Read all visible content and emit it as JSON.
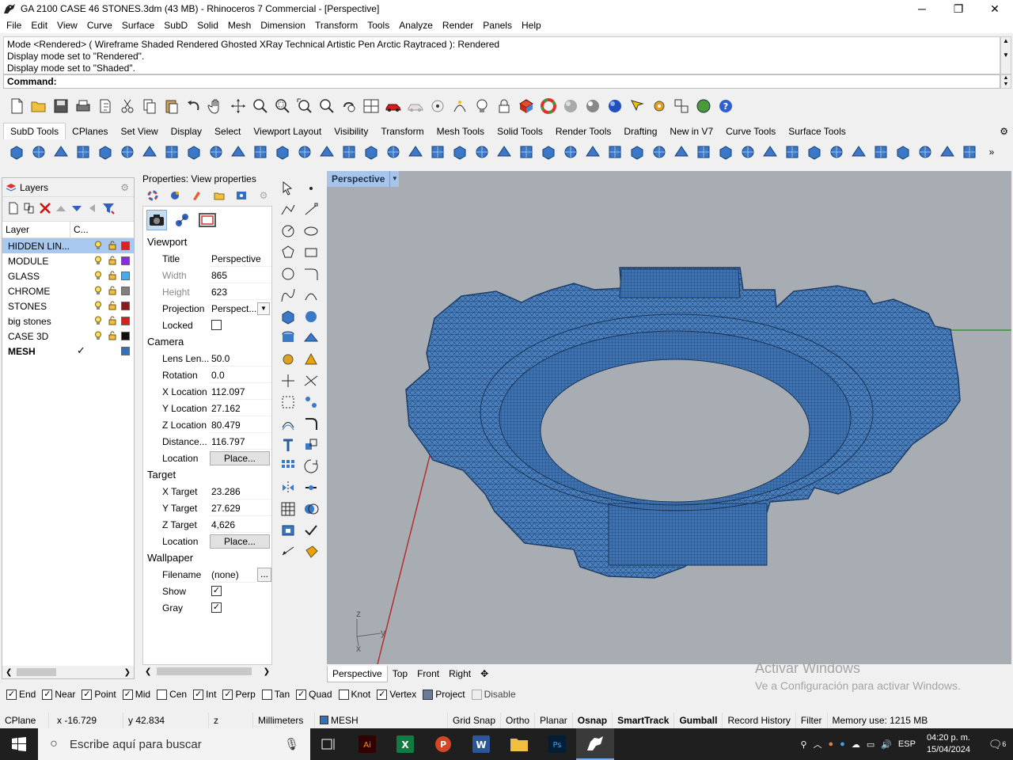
{
  "window": {
    "title": "GA 2100 CASE 46 STONES.3dm (43 MB) - Rhinoceros 7 Commercial - [Perspective]",
    "minimize": "─",
    "maximize": "❐",
    "close": "✕"
  },
  "menu": [
    "File",
    "Edit",
    "View",
    "Curve",
    "Surface",
    "SubD",
    "Solid",
    "Mesh",
    "Dimension",
    "Transform",
    "Tools",
    "Analyze",
    "Render",
    "Panels",
    "Help"
  ],
  "command_history": [
    "Mode <Rendered> ( Wireframe  Shaded  Rendered  Ghosted  XRay  Technical  Artistic  Pen  Arctic  Raytraced ): Rendered",
    "Display mode set to \"Rendered\".",
    "Display mode set to \"Shaded\"."
  ],
  "command_prompt": "Command:",
  "toolbar_tabs": [
    "SubD Tools",
    "CPlanes",
    "Set View",
    "Display",
    "Select",
    "Viewport Layout",
    "Visibility",
    "Transform",
    "Mesh Tools",
    "Solid Tools",
    "Render Tools",
    "Drafting",
    "New in V7",
    "Curve Tools",
    "Surface Tools"
  ],
  "active_toolbar_tab": "SubD Tools",
  "layers_panel": {
    "title": "Layers",
    "col_layer": "Layer",
    "col_color": "C...",
    "rows": [
      {
        "name": "HIDDEN LIN...",
        "color": "#e02020",
        "selected": true
      },
      {
        "name": "MODULE",
        "color": "#8a2be2"
      },
      {
        "name": "GLASS",
        "color": "#4aa8e8"
      },
      {
        "name": "CHROME",
        "color": "#808080"
      },
      {
        "name": "STONES",
        "color": "#8b1a1a"
      },
      {
        "name": "big stones",
        "color": "#d42020"
      },
      {
        "name": "CASE 3D",
        "color": "#101010"
      },
      {
        "name": "MESH",
        "color": "#3470b8",
        "current": true
      }
    ]
  },
  "properties_panel": {
    "title": "Properties: View properties",
    "viewport_section": "Viewport",
    "camera_section": "Camera",
    "target_section": "Target",
    "wallpaper_section": "Wallpaper",
    "title_label": "Title",
    "title_value": "Perspective",
    "width_label": "Width",
    "width_value": "865",
    "height_label": "Height",
    "height_value": "623",
    "projection_label": "Projection",
    "projection_value": "Perspect...",
    "locked_label": "Locked",
    "lens_label": "Lens Len...",
    "lens_value": "50.0",
    "rotation_label": "Rotation",
    "rotation_value": "0.0",
    "xloc_label": "X Location",
    "xloc_value": "112.097",
    "yloc_label": "Y Location",
    "yloc_value": "27.162",
    "zloc_label": "Z Location",
    "zloc_value": "80.479",
    "dist_label": "Distance...",
    "dist_value": "116.797",
    "location_label": "Location",
    "place_button": "Place...",
    "xtarget_label": "X Target",
    "xtarget_value": "23.286",
    "ytarget_label": "Y Target",
    "ytarget_value": "27.629",
    "ztarget_label": "Z Target",
    "ztarget_value": "4,626",
    "filename_label": "Filename",
    "filename_value": "(none)",
    "filename_button": "...",
    "show_label": "Show",
    "gray_label": "Gray"
  },
  "viewport": {
    "label": "Perspective",
    "axis_z": "z",
    "axis_y": "y",
    "axis_x": "x"
  },
  "viewport_tabs": [
    "Perspective",
    "Top",
    "Front",
    "Right"
  ],
  "viewport_add": "✥",
  "watermark": {
    "line1": "Activar Windows",
    "line2": "Ve a Configuración para activar Windows."
  },
  "osnaps": [
    {
      "label": "End",
      "checked": true
    },
    {
      "label": "Near",
      "checked": true
    },
    {
      "label": "Point",
      "checked": true
    },
    {
      "label": "Mid",
      "checked": true
    },
    {
      "label": "Cen",
      "checked": false
    },
    {
      "label": "Int",
      "checked": true
    },
    {
      "label": "Perp",
      "checked": true
    },
    {
      "label": "Tan",
      "checked": false
    },
    {
      "label": "Quad",
      "checked": true
    },
    {
      "label": "Knot",
      "checked": false
    },
    {
      "label": "Vertex",
      "checked": true
    },
    {
      "label": "Project",
      "checked": "filled"
    },
    {
      "label": "Disable",
      "checked": "disabled"
    }
  ],
  "statusbar": {
    "cplane": "CPlane",
    "x": "x -16.729",
    "y": "y 42.834",
    "z": "z",
    "units": "Millimeters",
    "layer": "MESH",
    "grid_snap": "Grid Snap",
    "ortho": "Ortho",
    "planar": "Planar",
    "osnap": "Osnap",
    "smarttrack": "SmartTrack",
    "gumball": "Gumball",
    "record_history": "Record History",
    "filter": "Filter",
    "memory": "Memory use: 1215 MB"
  },
  "taskbar": {
    "search_placeholder": "Escribe aquí para buscar",
    "lang": "ESP",
    "time": "04:20 p. m.",
    "date": "15/04/2024",
    "notif_count": "6"
  }
}
